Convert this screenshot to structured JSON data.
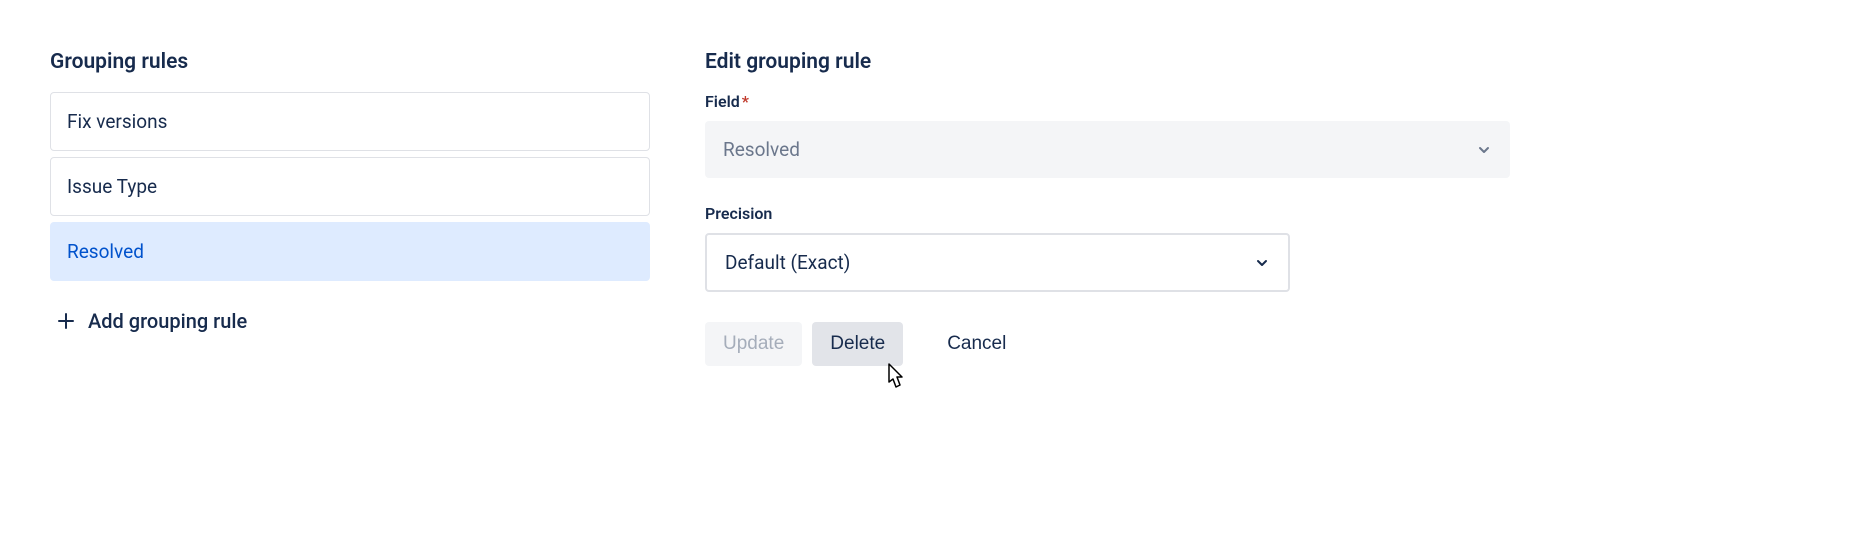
{
  "left": {
    "title": "Grouping rules",
    "rules": [
      {
        "label": "Fix versions",
        "selected": false
      },
      {
        "label": "Issue Type",
        "selected": false
      },
      {
        "label": "Resolved",
        "selected": true
      }
    ],
    "add_label": "Add grouping rule"
  },
  "right": {
    "title": "Edit grouping rule",
    "field": {
      "label": "Field",
      "required": "*",
      "value": "Resolved"
    },
    "precision": {
      "label": "Precision",
      "value": "Default (Exact)"
    },
    "buttons": {
      "update": "Update",
      "delete": "Delete",
      "cancel": "Cancel"
    }
  }
}
